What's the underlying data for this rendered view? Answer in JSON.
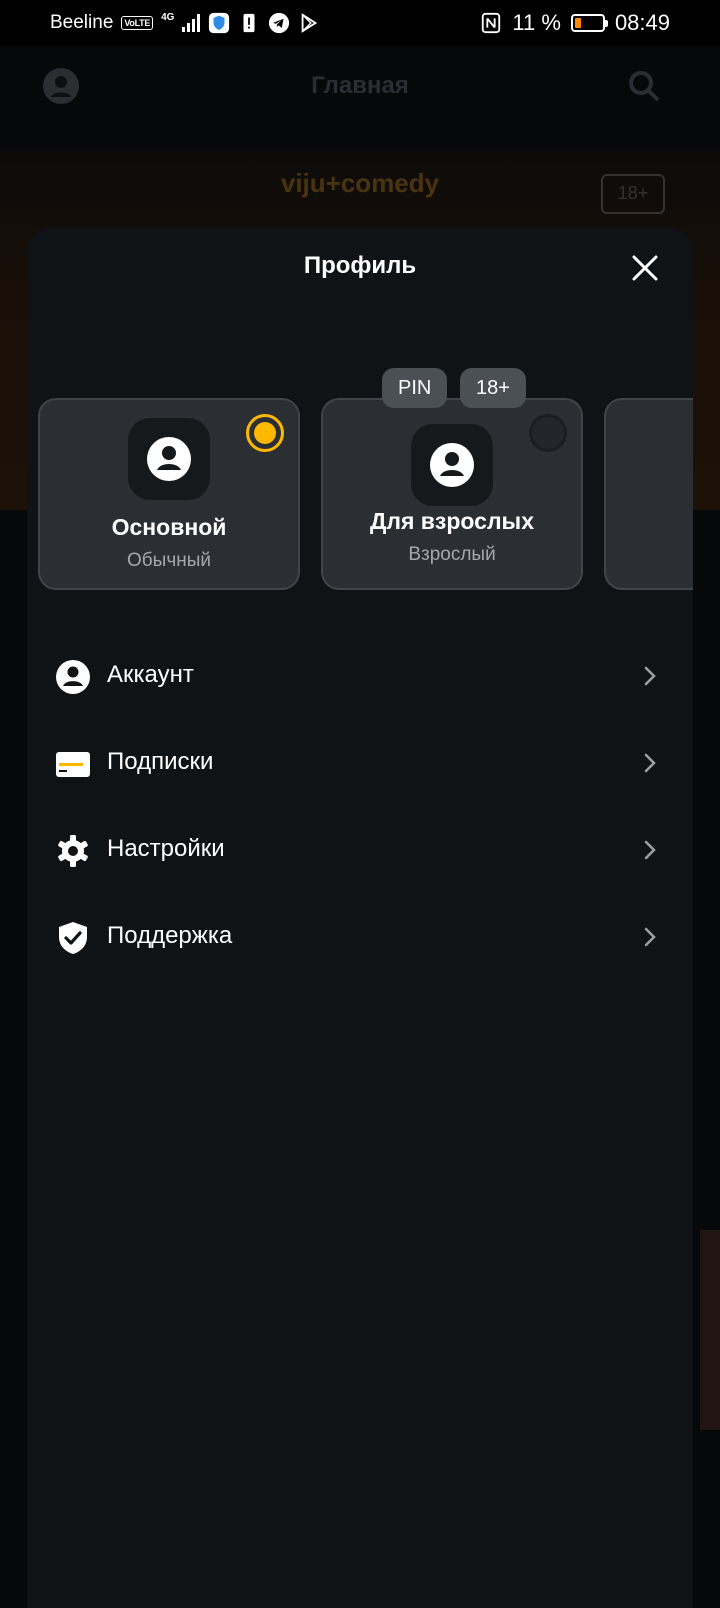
{
  "status_bar": {
    "carrier": "Beeline",
    "volte": "VoLTE",
    "network": "4G",
    "battery_percent": "11 %",
    "battery_level": 0.11,
    "time": "08:49"
  },
  "background": {
    "title": "Главная",
    "logo": "viju+comedy",
    "age_badge": "18+"
  },
  "sheet": {
    "title": "Профиль",
    "profiles": [
      {
        "name": "Основной",
        "type": "Обычный",
        "selected": true
      },
      {
        "name": "Для взрослых",
        "type": "Взрослый",
        "selected": false,
        "chips": [
          "PIN",
          "18+"
        ]
      }
    ],
    "menu": [
      {
        "label": "Аккаунт",
        "icon": "account-icon"
      },
      {
        "label": "Подписки",
        "icon": "card-icon"
      },
      {
        "label": "Настройки",
        "icon": "gear-icon"
      },
      {
        "label": "Поддержка",
        "icon": "shield-check-icon"
      }
    ]
  },
  "colors": {
    "accent": "#ffb800",
    "sheet_bg": "#101316",
    "card_bg": "#2b2f34"
  }
}
